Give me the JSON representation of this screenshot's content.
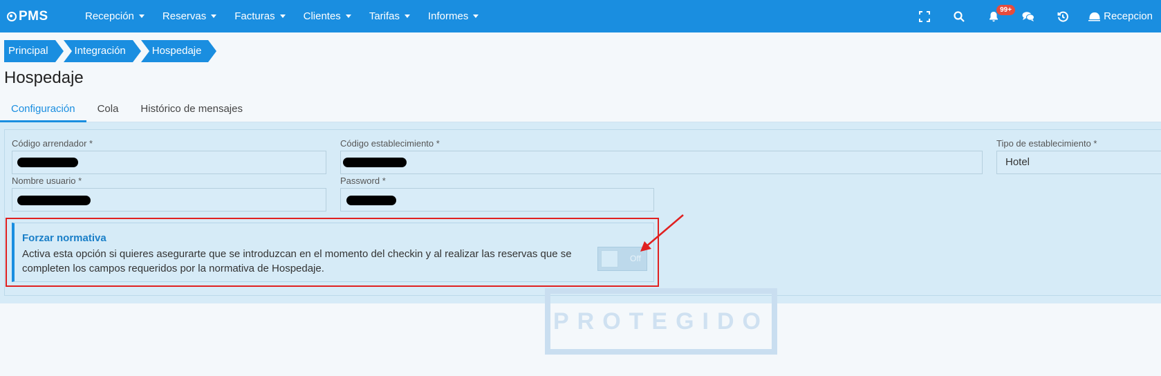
{
  "app": {
    "logo_text": "PMS"
  },
  "nav": {
    "items": [
      {
        "label": "Recepción"
      },
      {
        "label": "Reservas"
      },
      {
        "label": "Facturas"
      },
      {
        "label": "Clientes"
      },
      {
        "label": "Tarifas"
      },
      {
        "label": "Informes"
      }
    ],
    "notifications_badge": "99+",
    "user_label": "Recepcion",
    "icons": [
      "fullscreen-icon",
      "search-icon",
      "bell-icon",
      "chat-icon",
      "history-icon",
      "user-icon"
    ]
  },
  "breadcrumb": [
    {
      "label": "Principal"
    },
    {
      "label": "Integración"
    },
    {
      "label": "Hospedaje"
    }
  ],
  "page": {
    "title": "Hospedaje"
  },
  "tabs": [
    {
      "label": "Configuración",
      "active": true
    },
    {
      "label": "Cola",
      "active": false
    },
    {
      "label": "Histórico de mensajes",
      "active": false
    }
  ],
  "form": {
    "codigo_arrendador": {
      "label": "Código arrendador *",
      "value": ""
    },
    "codigo_establecimiento": {
      "label": "Código establecimiento *",
      "value": ""
    },
    "tipo_establecimiento": {
      "label": "Tipo de establecimiento *",
      "value": "Hotel"
    },
    "nombre_usuario": {
      "label": "Nombre usuario *",
      "value": ""
    },
    "password": {
      "label": "Password *",
      "value": ""
    }
  },
  "forzar_normativa": {
    "title": "Forzar normativa",
    "description": "Activa esta opción si quieres asegurarte que se introduzcan en el momento del checkin y al realizar las reservas que se completen los campos requeridos por la normativa de Hospedaje.",
    "toggle_label": "Off",
    "enabled": false
  },
  "watermark": {
    "text": "PROTEGIDO"
  },
  "colors": {
    "primary": "#1a8ee0",
    "panel": "#d6ebf7",
    "highlight": "#e02020",
    "badge": "#e74c3c"
  }
}
